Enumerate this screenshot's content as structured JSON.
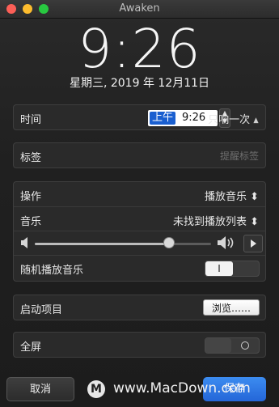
{
  "window": {
    "title": "Awaken"
  },
  "clock": {
    "time": "9:26",
    "date": "星期三, 2019 年 12月11日"
  },
  "time_row": {
    "label": "时间",
    "ampm": "上午",
    "value": "9:26",
    "repeat": "只响一次"
  },
  "tag_row": {
    "label": "标签",
    "placeholder": "提醒标签"
  },
  "action_row": {
    "label": "操作",
    "value": "播放音乐"
  },
  "music_row": {
    "label": "音乐",
    "value": "未找到播放列表"
  },
  "volume": {
    "level_pct": 76
  },
  "shuffle_row": {
    "label": "随机播放音乐",
    "toggle_on_label": "I"
  },
  "startup_row": {
    "label": "启动项目",
    "browse_label": "浏览……"
  },
  "fullscreen_row": {
    "label": "全屏"
  },
  "buttons": {
    "cancel": "取消",
    "save": "保存"
  },
  "watermark": {
    "text": "www.MacDown.com"
  },
  "colors": {
    "accent": "#2466d8",
    "toggle_on": "#f2f2f2"
  }
}
